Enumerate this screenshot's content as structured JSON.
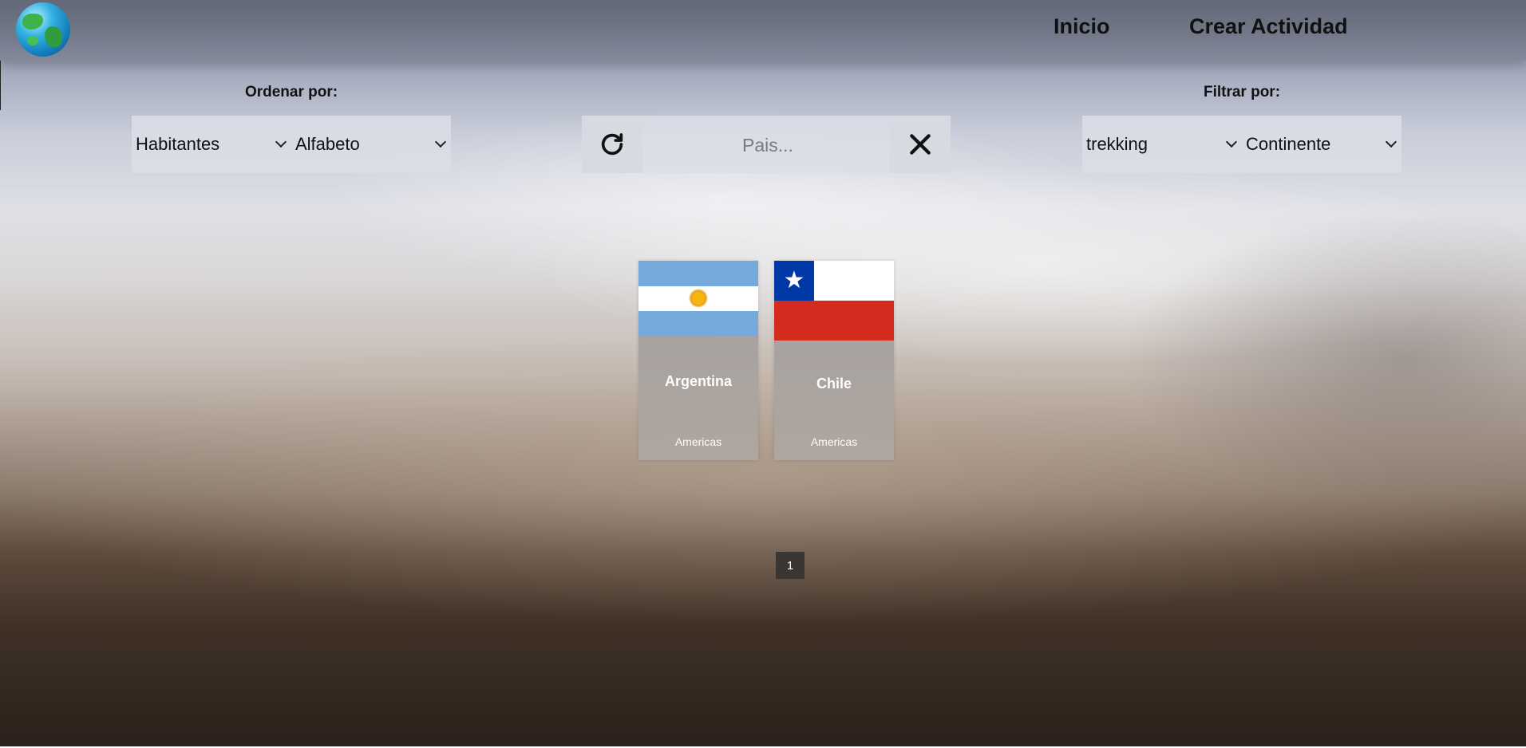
{
  "nav": {
    "home_label": "Inicio",
    "create_activity_label": "Crear Actividad"
  },
  "sort": {
    "label": "Ordenar por:",
    "population_select": "Habitantes",
    "alphabet_select": "Alfabeto"
  },
  "search": {
    "placeholder": "Pais...",
    "value": "",
    "reload_icon": "reload-icon",
    "clear_icon": "close-icon"
  },
  "filter": {
    "label": "Filtrar por:",
    "activity_select": "trekking",
    "continent_select": "Continente"
  },
  "countries": [
    {
      "name": "Argentina",
      "continent": "Americas",
      "flag": "argentina-flag"
    },
    {
      "name": "Chile",
      "continent": "Americas",
      "flag": "chile-flag"
    }
  ],
  "pagination": {
    "pages": [
      "1"
    ],
    "current": "1"
  },
  "logo_icon": "globe-icon"
}
